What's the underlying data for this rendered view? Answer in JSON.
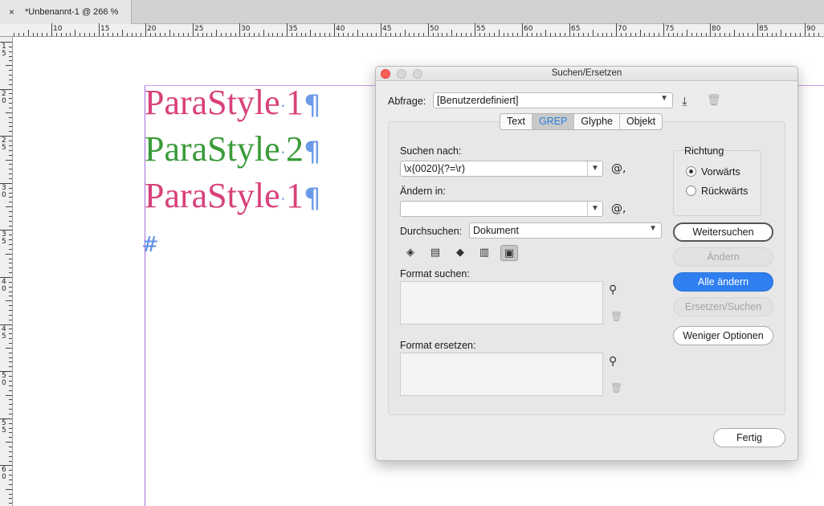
{
  "document_tab": {
    "close_glyph": "×",
    "title": "*Unbenannt-1 @ 266 %"
  },
  "ruler": {
    "h_labels": [
      "10",
      "15",
      "20",
      "25",
      "30",
      "35",
      "40",
      "45",
      "50",
      "55",
      "60",
      "65",
      "70",
      "75",
      "80",
      "85",
      "90"
    ],
    "v_labels": [
      "1\n5",
      "2\n0",
      "2\n5",
      "3\n0",
      "3\n5",
      "4\n0",
      "4\n5",
      "5\n0",
      "5\n5",
      "6\n0"
    ]
  },
  "canvas": {
    "lines": [
      {
        "word": "ParaStyle",
        "dot": "·",
        "num": "1",
        "pilcrow": "¶",
        "color": "#d9417a"
      },
      {
        "word": "ParaStyle",
        "dot": "·",
        "num": "2",
        "pilcrow": "¶",
        "color": "#3a9b3a"
      },
      {
        "word": "ParaStyle",
        "dot": "·",
        "num": "1",
        "pilcrow": "¶",
        "color": "#d9417a"
      }
    ],
    "end_marker": "#"
  },
  "dialog": {
    "title": "Suchen/Ersetzen",
    "query_label": "Abfrage:",
    "query_value": "[Benutzerdefiniert]",
    "tabs": [
      "Text",
      "GREP",
      "Glyphe",
      "Objekt"
    ],
    "active_tab": "GREP",
    "find_label": "Suchen nach:",
    "find_value": "\\x{0020}(?=\\r)",
    "change_label": "Ändern in:",
    "change_value": "",
    "search_label": "Durchsuchen:",
    "search_value": "Dokument",
    "format_find_label": "Format suchen:",
    "format_change_label": "Format ersetzen:",
    "direction_label": "Richtung",
    "direction_options": [
      "Vorwärts",
      "Rückwärts"
    ],
    "direction_selected": "Vorwärts",
    "buttons": {
      "find_next": "Weitersuchen",
      "change": "Ändern",
      "change_all": "Alle ändern",
      "change_find": "Ersetzen/Suchen",
      "fewer_options": "Weniger Optionen",
      "done": "Fertig"
    },
    "special_char_glyph": "@,"
  },
  "colors": {
    "accent": "#2f7ff0",
    "guide": "#a46bd8"
  }
}
